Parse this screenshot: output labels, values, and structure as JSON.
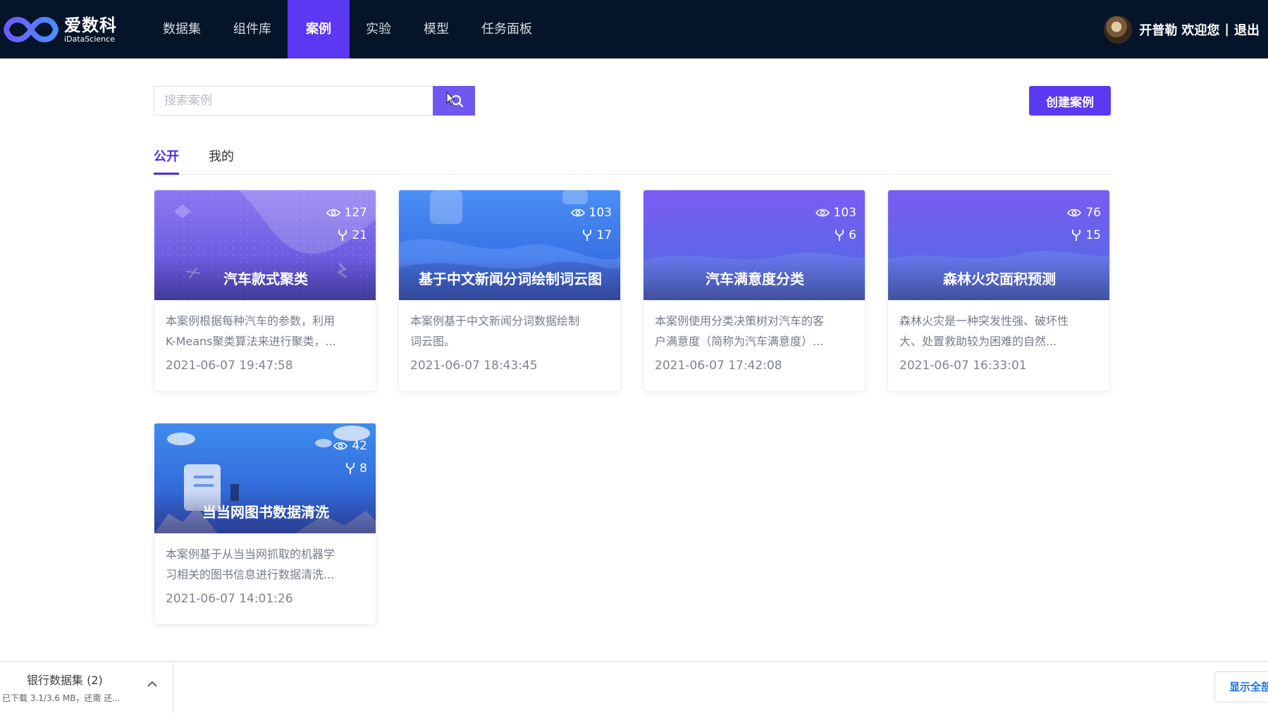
{
  "app": {
    "logo_cn": "爱数科",
    "logo_en": "iDataScience"
  },
  "nav": {
    "items": [
      "数据集",
      "组件库",
      "案例",
      "实验",
      "模型",
      "任务面板"
    ],
    "active_index": 2
  },
  "user": {
    "name": "开普勒",
    "welcome": "欢迎您",
    "separator": "|",
    "logout": "退出"
  },
  "search": {
    "placeholder": "搜索案例",
    "value": ""
  },
  "create_button": "创建案例",
  "tabs": {
    "public": "公开",
    "mine": "我的",
    "active": "公开"
  },
  "cards": [
    {
      "title": "汽车款式聚类",
      "views": "127",
      "forks": "21",
      "desc_line1": "本案例根据每种汽车的参数，利用",
      "desc_line2": "K-Means聚类算法来进行聚类，...",
      "date": "2021-06-07 19:47:58",
      "theme": "purple-pattern"
    },
    {
      "title": "基于中文新闻分词绘制词云图",
      "views": "103",
      "forks": "17",
      "desc_line1": "本案例基于中文新闻分词数据绘制",
      "desc_line2": "词云图。",
      "date": "2021-06-07 18:43:45",
      "theme": "blue-wave"
    },
    {
      "title": "汽车满意度分类",
      "views": "103",
      "forks": "6",
      "desc_line1": "本案例使用分类决策树对汽车的客",
      "desc_line2": "户满意度（简称为汽车满意度）...",
      "date": "2021-06-07 17:42:08",
      "theme": "violet-blue"
    },
    {
      "title": "森林火灾面积预测",
      "views": "76",
      "forks": "15",
      "desc_line1": "森林火灾是一种突发性强、破坏性",
      "desc_line2": "大、处置救助较为困难的自然...",
      "date": "2021-06-07 16:33:01",
      "theme": "violet-blue"
    },
    {
      "title": "当当网图书数据清洗",
      "views": "42",
      "forks": "8",
      "desc_line1": "本案例基于从当当网抓取的机器学",
      "desc_line2": "习相关的图书信息进行数据清洗...",
      "date": "2021-06-07 14:01:26",
      "theme": "blue-clouds"
    }
  ],
  "download_bar": {
    "file_name": "银行数据集 (2)",
    "status": "已下载 3.1/3.6 MB，还需 还...",
    "show_all": "显示全部"
  },
  "colors": {
    "nav_bg": "#051428",
    "accent": "#5b38f2",
    "tab_active": "#4a2ee8",
    "link_blue": "#1a73e8"
  },
  "icons": [
    "logo-infinity-icon",
    "search-icon",
    "eye-icon",
    "fork-icon",
    "chevron-up-icon",
    "mouse-cursor-icon"
  ]
}
